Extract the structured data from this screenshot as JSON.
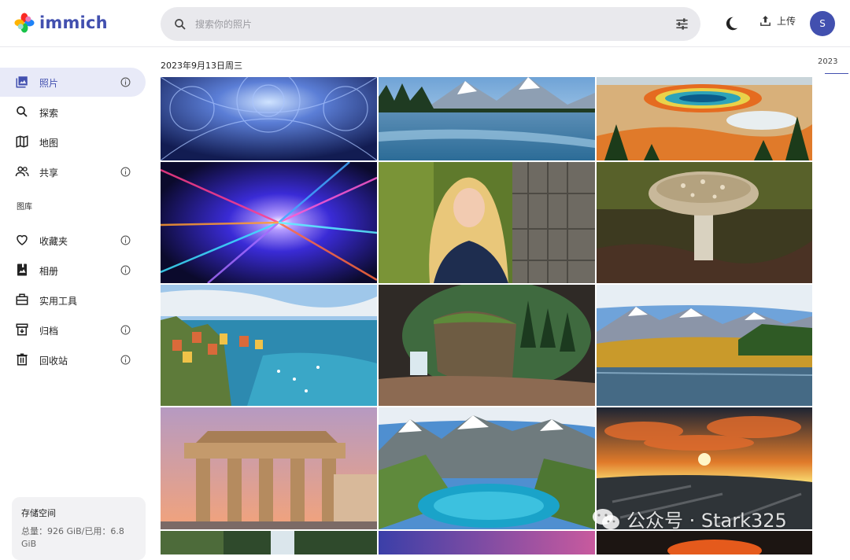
{
  "app": {
    "name": "immich"
  },
  "search": {
    "placeholder": "搜索你的照片"
  },
  "header": {
    "upload_label": "上传",
    "avatar_initial": "S"
  },
  "sidebar": {
    "items": [
      {
        "label": "照片",
        "icon": "photos-icon",
        "active": true,
        "info": true
      },
      {
        "label": "探索",
        "icon": "search-icon",
        "active": false,
        "info": false
      },
      {
        "label": "地图",
        "icon": "map-icon",
        "active": false,
        "info": false
      },
      {
        "label": "共享",
        "icon": "people-icon",
        "active": false,
        "info": true
      }
    ],
    "library_label": "图库",
    "library_items": [
      {
        "label": "收藏夹",
        "icon": "heart-icon",
        "info": true
      },
      {
        "label": "相册",
        "icon": "album-icon",
        "info": true
      },
      {
        "label": "实用工具",
        "icon": "toolbox-icon",
        "info": false
      },
      {
        "label": "归档",
        "icon": "archive-icon",
        "info": true
      },
      {
        "label": "回收站",
        "icon": "trash-icon",
        "info": true
      }
    ],
    "storage": {
      "title": "存储空间",
      "value": "总量：926 GiB/已用：6.8 GiB"
    }
  },
  "timeline": {
    "date_heading": "2023年9月13日周三",
    "scrubber_year": "2023",
    "photos": [
      "fractal-kaleidoscope",
      "mountain-lake-canoe",
      "hot-spring",
      "light-burst",
      "blonde-woman",
      "mushroom",
      "cinque-terre",
      "cave-waterfall",
      "autumn-mountain-lake",
      "brandenburg-gate",
      "alpine-lake",
      "rocky-sunset",
      "forest-waterfall",
      "purple-sky",
      "fire-sky"
    ]
  },
  "watermark": {
    "text": "公众号 · Stark325"
  },
  "colors": {
    "accent": "#4250af",
    "active_bg": "#e8eaf8",
    "search_bg": "#e9e9ed"
  }
}
